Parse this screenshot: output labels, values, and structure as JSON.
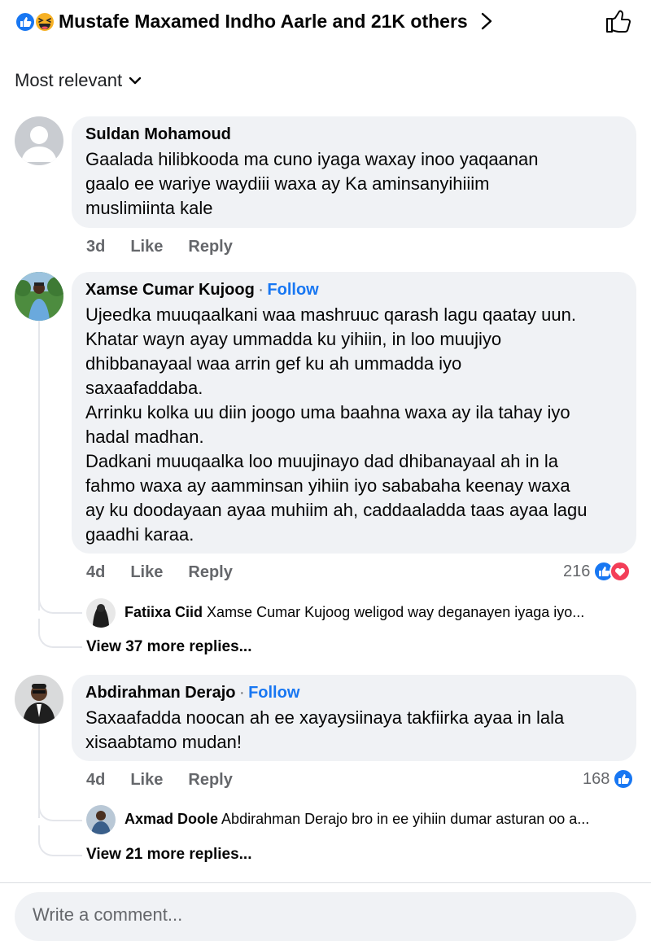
{
  "header": {
    "reactions_text": "Mustafe Maxamed Indho Aarle and 21K others",
    "reaction_icons": [
      "like-icon",
      "haha-icon"
    ]
  },
  "sort": {
    "label": "Most relevant"
  },
  "comments": [
    {
      "author": "Suldan Mohamoud",
      "text": "Gaalada hilibkooda ma cuno iyaga waxay inoo yaqaanan\ngaalo ee wariye waydiii waxa ay Ka aminsanyihiiim\nmuslimiinta kale",
      "time": "3d",
      "like": "Like",
      "reply": "Reply"
    },
    {
      "author": "Xamse Cumar Kujoog",
      "separator": "·",
      "follow": "Follow",
      "text": "Ujeedka muuqaalkani waa mashruuc qarash lagu qaatay uun.\nKhatar wayn ayay ummadda ku yihiin, in loo muujiyo\ndhibbanayaal waa arrin gef ku ah ummadda iyo\nsaxaafaddaba.\nArrinku kolka uu diin joogo uma baahna waxa ay ila tahay iyo\nhadal madhan.\nDadkani muuqaalka loo muujinayo dad dhibanayaal ah in la\nfahmo waxa ay aamminsan yihiin iyo sababaha keenay waxa\nay ku doodayaan ayaa muhiim ah, caddaaladda taas ayaa lagu\ngaadhi karaa.",
      "time": "4d",
      "like": "Like",
      "reply": "Reply",
      "reactions_count": "216",
      "reply_preview": {
        "author": "Fatiixa Ciid",
        "text": "Xamse Cumar Kujoog weligod way deganayen iyaga iyo..."
      },
      "more_replies": "View 37 more replies..."
    },
    {
      "author": "Abdirahman Derajo",
      "separator": "·",
      "follow": "Follow",
      "text": "Saxaafadda noocan ah ee xayaysiinaya takfiirka ayaa in lala\nxisaabtamo mudan!",
      "time": "4d",
      "like": "Like",
      "reply": "Reply",
      "reactions_count": "168",
      "reply_preview": {
        "author": "Axmad Doole",
        "text": "Abdirahman Derajo bro in ee yihiin dumar asturan oo a..."
      },
      "more_replies": "View 21 more replies..."
    }
  ],
  "composer": {
    "placeholder": "Write a comment..."
  },
  "colors": {
    "accent": "#1877f2",
    "love": "#f33e58",
    "bubble": "#f0f2f5",
    "muted": "#65676b"
  }
}
